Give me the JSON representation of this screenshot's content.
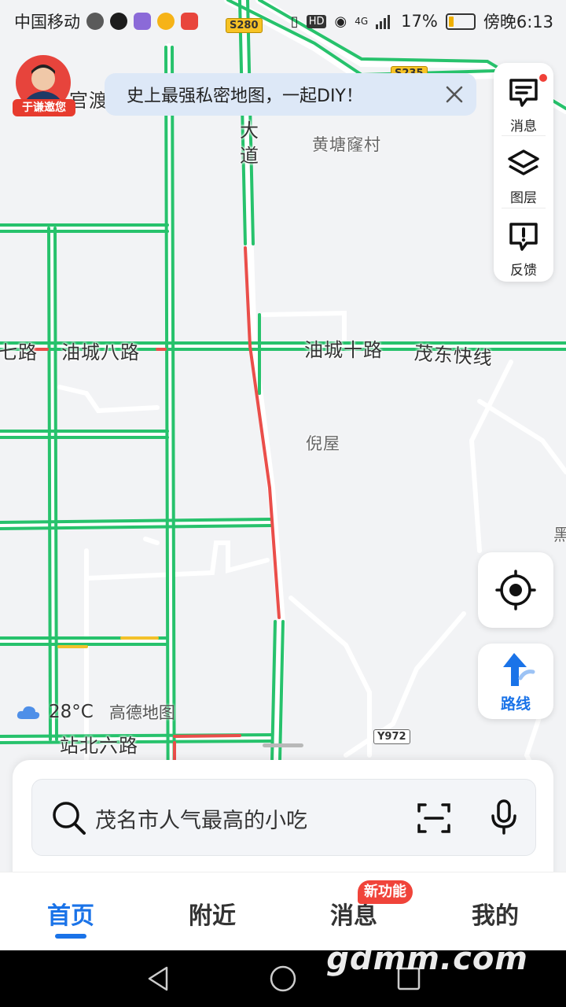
{
  "status_bar": {
    "carrier": "中国移动",
    "network": "HD",
    "signal": "4G",
    "battery": "17%",
    "time": "傍晚6:13"
  },
  "map": {
    "road_shields": [
      "S280",
      "S235",
      "Y972"
    ],
    "labels": {
      "village1": "黄塘窿村",
      "village2": "倪屋",
      "road_ba": "油城八路",
      "road_qi": "七路",
      "road_shi": "油城十路",
      "expressway": "茂东快线",
      "road_bei6": "站北六路",
      "avenue": "大道",
      "du": "官渡",
      "edge": "黑"
    }
  },
  "banner": {
    "text": "史上最强私密地图，一起DIY！",
    "close_icon": "close-icon"
  },
  "avatar": {
    "tag": "于谦邀您"
  },
  "tools": {
    "message": "消息",
    "layers": "图层",
    "feedback": "反馈"
  },
  "route_button": "路线",
  "weather": {
    "temp": "28°C",
    "brand": "高德地图"
  },
  "search": {
    "placeholder": "茂名市人气最高的小吃"
  },
  "tabs": [
    {
      "label": "首页"
    },
    {
      "label": "附近"
    },
    {
      "label": "消息"
    },
    {
      "label": "我的"
    }
  ],
  "tab_badge": "新功能",
  "watermark": "gdmm.com",
  "colors": {
    "traffic_smooth": "#27c26c",
    "traffic_jam": "#ea4e4a",
    "traffic_slow": "#f3c12a",
    "accent": "#1a73e8"
  }
}
